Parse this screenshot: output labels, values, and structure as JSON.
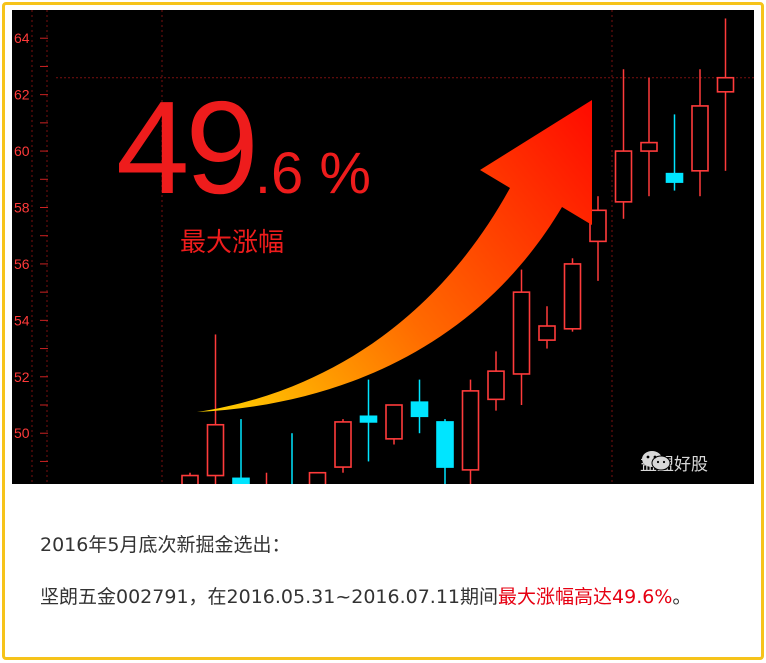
{
  "chart_data": {
    "type": "candlestick",
    "y_ticks": [
      "64",
      "62",
      "60",
      "58",
      "56",
      "54",
      "52",
      "50"
    ],
    "ylim": [
      48.2,
      65.0
    ],
    "reference_line": 62.6,
    "grid": true,
    "up_color": "#ff3b3b",
    "down_color": "#00e5ff",
    "candles": [
      {
        "open": 47.0,
        "close": 48.5,
        "high": 48.6,
        "low": 46.5,
        "dir": "up"
      },
      {
        "open": 48.5,
        "close": 50.3,
        "high": 53.5,
        "low": 47.5,
        "dir": "up"
      },
      {
        "open": 48.4,
        "close": 48.0,
        "high": 50.5,
        "low": 47.0,
        "dir": "down"
      },
      {
        "open": 47.5,
        "close": 48.0,
        "high": 48.6,
        "low": 46.8,
        "dir": "up"
      },
      {
        "open": 48.0,
        "close": 47.5,
        "high": 50.0,
        "low": 47.0,
        "dir": "down"
      },
      {
        "open": 47.5,
        "close": 48.6,
        "high": 48.6,
        "low": 47.0,
        "dir": "up"
      },
      {
        "open": 48.8,
        "close": 50.4,
        "high": 50.5,
        "low": 48.6,
        "dir": "up"
      },
      {
        "open": 50.6,
        "close": 50.4,
        "high": 51.9,
        "low": 49.0,
        "dir": "down"
      },
      {
        "open": 49.8,
        "close": 51.0,
        "high": 51.0,
        "low": 49.6,
        "dir": "up"
      },
      {
        "open": 51.1,
        "close": 50.6,
        "high": 51.9,
        "low": 50.0,
        "dir": "down"
      },
      {
        "open": 50.4,
        "close": 48.8,
        "high": 50.5,
        "low": 48.2,
        "dir": "down"
      },
      {
        "open": 48.7,
        "close": 51.5,
        "high": 51.9,
        "low": 48.2,
        "dir": "up"
      },
      {
        "open": 51.2,
        "close": 52.2,
        "high": 52.9,
        "low": 50.8,
        "dir": "up"
      },
      {
        "open": 52.1,
        "close": 55.0,
        "high": 55.8,
        "low": 51.0,
        "dir": "up"
      },
      {
        "open": 53.3,
        "close": 53.8,
        "high": 54.5,
        "low": 53.0,
        "dir": "up"
      },
      {
        "open": 53.7,
        "close": 56.0,
        "high": 56.2,
        "low": 53.6,
        "dir": "up"
      },
      {
        "open": 56.8,
        "close": 57.9,
        "high": 58.4,
        "low": 55.4,
        "dir": "up"
      },
      {
        "open": 58.2,
        "close": 60.0,
        "high": 62.9,
        "low": 57.6,
        "dir": "up"
      },
      {
        "open": 60.0,
        "close": 60.3,
        "high": 62.6,
        "low": 58.4,
        "dir": "up"
      },
      {
        "open": 59.2,
        "close": 58.9,
        "high": 61.3,
        "low": 58.6,
        "dir": "down"
      },
      {
        "open": 59.3,
        "close": 61.6,
        "high": 62.9,
        "low": 58.4,
        "dir": "up"
      },
      {
        "open": 62.1,
        "close": 62.6,
        "high": 64.7,
        "low": 59.3,
        "dir": "up"
      }
    ],
    "annotation_value": "49",
    "annotation_suffix": ".6 %",
    "annotation_label": "最大涨幅"
  },
  "watermark": {
    "icon": "wechat-icon",
    "text": "益盟好股"
  },
  "caption": {
    "line1": "2016年5月底次新掘金选出：",
    "line2_prefix": "坚朗五金002791，在2016.05.31~2016.07.11期间",
    "line2_highlight": "最大涨幅高达49.6%",
    "line2_suffix": "。"
  },
  "colors": {
    "border": "#f6c31a",
    "highlight": "#e60012",
    "annotation": "#ee1c1c"
  }
}
